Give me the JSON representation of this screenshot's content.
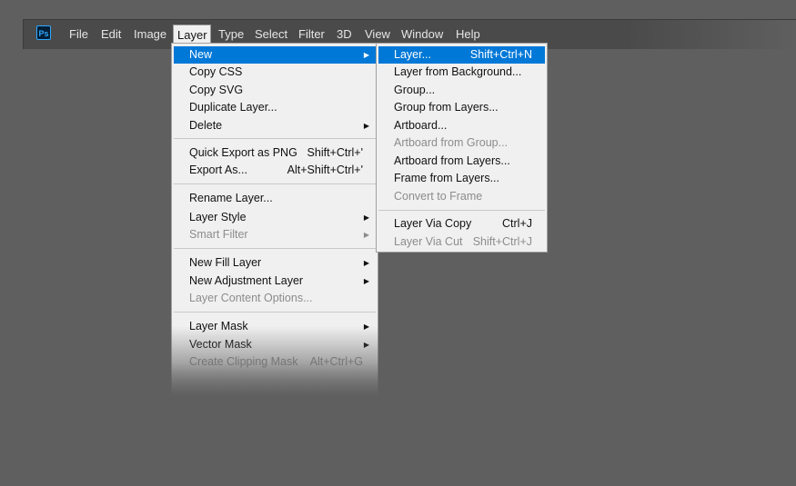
{
  "app": {
    "logo_text": "Ps"
  },
  "menubar": {
    "items": [
      "File",
      "Edit",
      "Image",
      "Layer",
      "Type",
      "Select",
      "Filter",
      "3D",
      "View",
      "Window",
      "Help"
    ],
    "active": "Layer"
  },
  "layer_menu": {
    "new": "New",
    "copy_css": "Copy CSS",
    "copy_svg": "Copy SVG",
    "duplicate_layer": "Duplicate Layer...",
    "delete": "Delete",
    "quick_export": "Quick Export as PNG",
    "quick_export_sc": "Shift+Ctrl+'",
    "export_as": "Export As...",
    "export_as_sc": "Alt+Shift+Ctrl+'",
    "rename_layer": "Rename Layer...",
    "layer_style": "Layer Style",
    "smart_filter": "Smart Filter",
    "new_fill_layer": "New Fill Layer",
    "new_adjustment_layer": "New Adjustment Layer",
    "layer_content_options": "Layer Content Options...",
    "layer_mask": "Layer Mask",
    "vector_mask": "Vector Mask",
    "create_clipping_mask": "Create Clipping Mask",
    "create_clipping_mask_sc": "Alt+Ctrl+G"
  },
  "new_menu": {
    "layer": "Layer...",
    "layer_sc": "Shift+Ctrl+N",
    "layer_from_background": "Layer from Background...",
    "group": "Group...",
    "group_from_layers": "Group from Layers...",
    "artboard": "Artboard...",
    "artboard_from_group": "Artboard from Group...",
    "artboard_from_layers": "Artboard from Layers...",
    "frame_from_layers": "Frame from Layers...",
    "convert_to_frame": "Convert to Frame",
    "layer_via_copy": "Layer Via Copy",
    "layer_via_copy_sc": "Ctrl+J",
    "layer_via_cut": "Layer Via Cut",
    "layer_via_cut_sc": "Shift+Ctrl+J"
  },
  "colors": {
    "highlight": "#0078d7",
    "menu_bg": "#f0f0f0",
    "workspace": "#5f5f5f",
    "disabled": "#8c8c8c"
  }
}
